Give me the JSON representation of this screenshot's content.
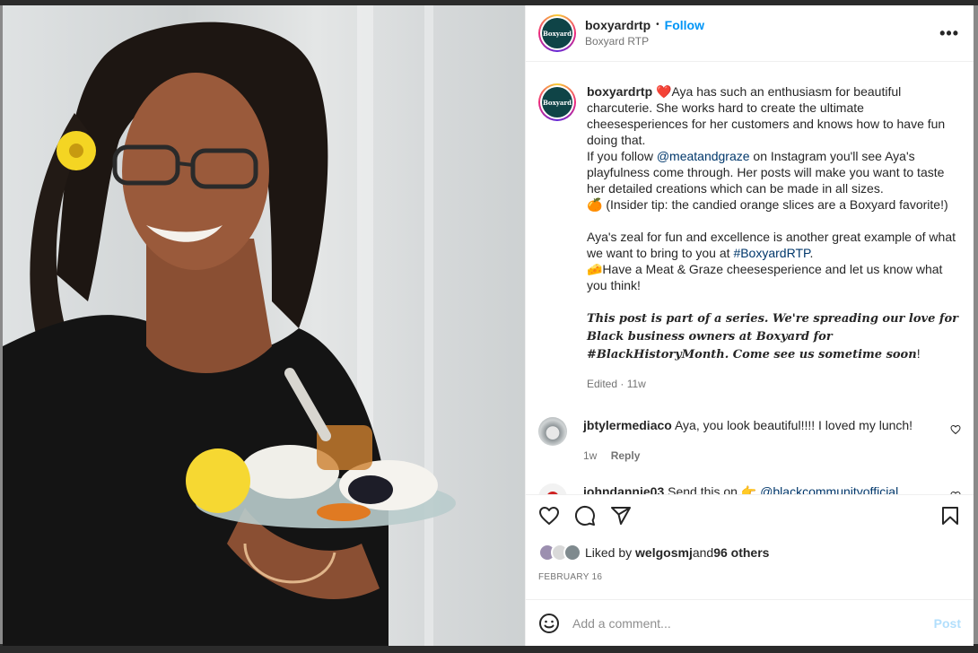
{
  "post": {
    "username": "boxyardrtp",
    "follow_label": "Follow",
    "subtitle": "Boxyard RTP",
    "more_label": "•••",
    "avatar_text": "Boxyard"
  },
  "caption": {
    "username": "boxyardrtp",
    "emoji_heart": "❤️",
    "p1": "Aya has such an enthusiasm for beautiful charcuterie. She works hard to create the ultimate cheesesperiences for her customers and knows how to have fun doing that.",
    "p2_before": "If you follow ",
    "p2_mention": "@meatandgraze",
    "p2_after": " on Instagram you'll see Aya's playfulness come through. Her posts will make you want to taste her detailed creations which can be made in all sizes.",
    "p3": "🍊 (Insider tip: the candied orange slices are a Boxyard favorite!)",
    "p4_before": "Aya's zeal for fun and excellence is another great example of what we want to bring to you at ",
    "p4_tag": "#BoxyardRTP",
    "p4_after": ".",
    "p5": "🧀Have a Meat & Graze cheesesperience and let us know what you think!",
    "p6_italic": "This post is part of a series. We're spreading our love for Black business owners at Boxyard for #BlackHistoryMonth. Come see us sometime soon",
    "p6_end": "!",
    "meta": "Edited · 11w"
  },
  "comments": [
    {
      "username": "jbtylermediaco",
      "text": "Aya, you look beautiful!!!! I loved my lunch!",
      "time": "1w",
      "reply_label": "Reply"
    },
    {
      "username": "johndannie03",
      "text_before": "Send this on ",
      "emoji": "👉",
      "mention": "@blackcommunityofficial"
    }
  ],
  "likes": {
    "prefix": "Liked by ",
    "user": "welgosmj",
    "and": " and ",
    "others": "96 others"
  },
  "date": "FEBRUARY 16",
  "add_comment": {
    "placeholder": "Add a comment...",
    "post_label": "Post"
  },
  "colors": {
    "follow": "#0095f6",
    "mention": "#00376b",
    "post_disabled": "#b2dffc",
    "brand_avatar": "#0f4447"
  },
  "icons": [
    "heart-icon",
    "comment-icon",
    "share-icon",
    "bookmark-icon",
    "emoji-icon",
    "more-icon"
  ]
}
